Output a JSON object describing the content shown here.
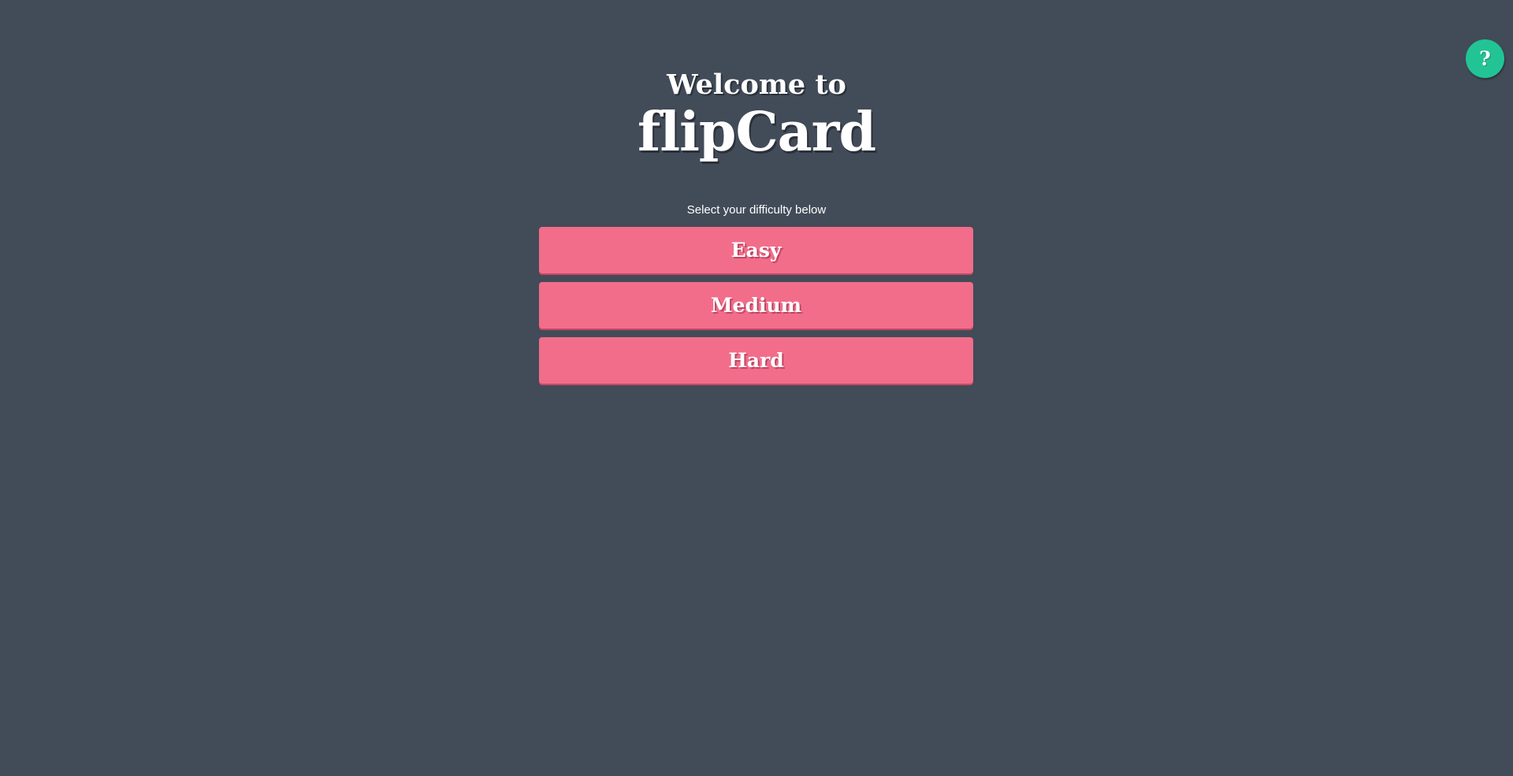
{
  "header": {
    "welcome": "Welcome to",
    "title": "flipCard"
  },
  "main": {
    "instruction": "Select your difficulty below",
    "difficulties": [
      {
        "label": "Easy"
      },
      {
        "label": "Medium"
      },
      {
        "label": "Hard"
      }
    ]
  },
  "help": {
    "label": "?",
    "icon": "question-mark-icon"
  },
  "colors": {
    "background": "#424b58",
    "button": "#f26d8a",
    "help_button": "#22c495",
    "text": "#ffffff"
  }
}
